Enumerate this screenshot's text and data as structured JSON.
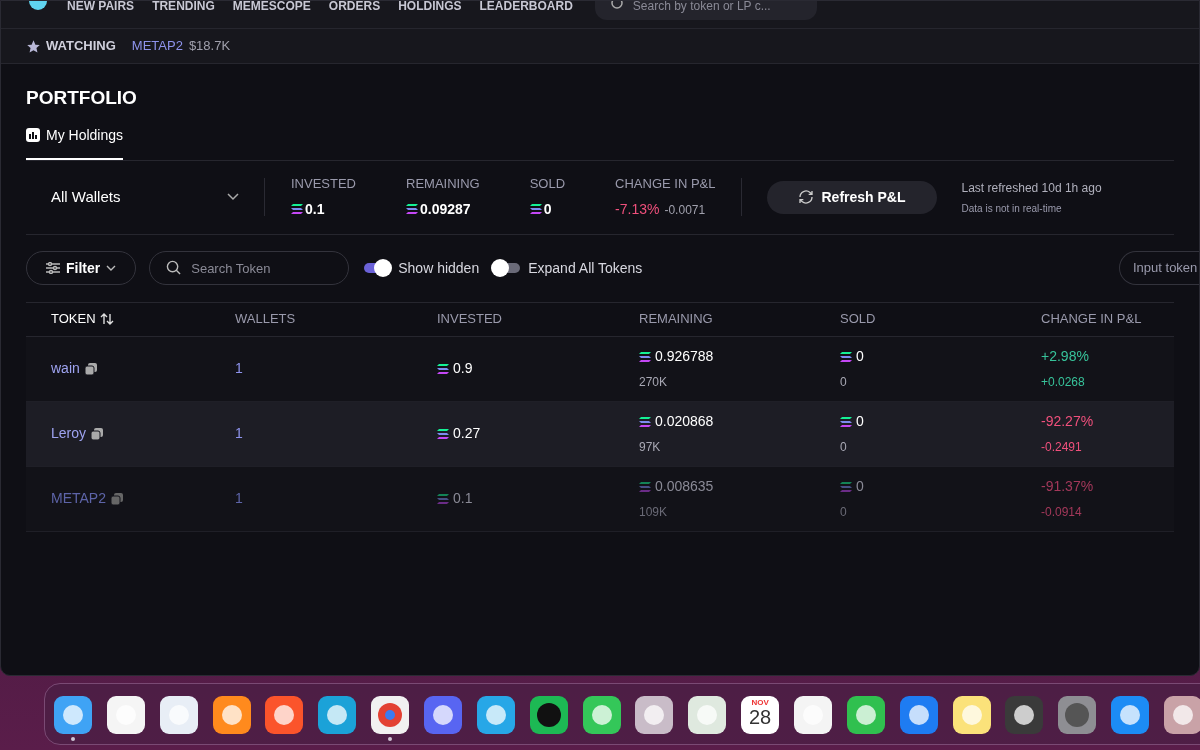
{
  "nav": {
    "items": [
      "NEW PAIRS",
      "TRENDING",
      "MEMESCOPE",
      "ORDERS",
      "HOLDINGS",
      "LEADERBOARD"
    ],
    "search": {
      "placeholder": "Search by token or LP c..."
    }
  },
  "watchlist": {
    "label": "WATCHING",
    "items": [
      {
        "symbol": "METAP2",
        "price": "$18.7K"
      }
    ]
  },
  "page_title": "PORTFOLIO",
  "tabs": [
    {
      "label": "My Holdings",
      "selected": true
    }
  ],
  "summary": {
    "wallet_select": "All Wallets",
    "stats": [
      {
        "label": "INVESTED",
        "value": "0.1",
        "kind": "sol"
      },
      {
        "label": "REMAINING",
        "value": "0.09287",
        "kind": "sol"
      },
      {
        "label": "SOLD",
        "value": "0",
        "kind": "sol"
      },
      {
        "label": "CHANGE IN P&L",
        "value": "-7.13%",
        "sub": "-0.0071",
        "kind": "pnl",
        "positive": false
      }
    ],
    "refresh_button": "Refresh P&L",
    "last_refreshed": "Last refreshed 10d 1h ago",
    "note": "Data is not in real-time"
  },
  "toolbar": {
    "filter": "Filter",
    "search": {
      "placeholder": "Search Token"
    },
    "toggles": [
      {
        "label": "Show hidden",
        "on": true
      },
      {
        "label": "Expand All Tokens",
        "on": false
      }
    ],
    "input": {
      "placeholder": "Input token"
    }
  },
  "table": {
    "columns": [
      "TOKEN",
      "WALLETS",
      "INVESTED",
      "REMAINING",
      "SOLD",
      "CHANGE IN P&L"
    ],
    "rows": [
      {
        "token": "wain",
        "wallets": "1",
        "invested": "0.9",
        "remaining": "0.926788",
        "remaining_sub": "270K",
        "sold": "0",
        "sold_sub": "0",
        "pnl": "+2.98%",
        "pnl_sub": "+0.0268",
        "positive": true,
        "hidden": false,
        "selected": false
      },
      {
        "token": "Leroy",
        "wallets": "1",
        "invested": "0.27",
        "remaining": "0.020868",
        "remaining_sub": "97K",
        "sold": "0",
        "sold_sub": "0",
        "pnl": "-92.27%",
        "pnl_sub": "-0.2491",
        "positive": false,
        "hidden": false,
        "selected": true
      },
      {
        "token": "METAP2",
        "wallets": "1",
        "invested": "0.1",
        "remaining": "0.008635",
        "remaining_sub": "109K",
        "sold": "0",
        "sold_sub": "0",
        "pnl": "-91.37%",
        "pnl_sub": "-0.0914",
        "positive": false,
        "hidden": true,
        "selected": false
      }
    ]
  },
  "dock": {
    "apps": [
      {
        "kind": "finder",
        "running": true
      },
      {
        "kind": "photos",
        "running": false
      },
      {
        "kind": "compass",
        "running": false
      },
      {
        "kind": "fox",
        "running": false
      },
      {
        "kind": "lion",
        "running": false
      },
      {
        "kind": "wave",
        "running": false
      },
      {
        "kind": "chrome",
        "running": true
      },
      {
        "kind": "chat",
        "running": false
      },
      {
        "kind": "plane",
        "running": false
      },
      {
        "kind": "music",
        "running": false
      },
      {
        "kind": "bubble",
        "running": false
      },
      {
        "kind": "grid",
        "running": false
      },
      {
        "kind": "map",
        "running": false
      },
      {
        "kind": "calendar",
        "running": false,
        "month": "NOV",
        "day": "28"
      },
      {
        "kind": "camera",
        "running": false
      },
      {
        "kind": "video",
        "running": false
      },
      {
        "kind": "easel",
        "running": false
      },
      {
        "kind": "notes",
        "running": false
      },
      {
        "kind": "calc",
        "running": false
      },
      {
        "kind": "gear",
        "running": false
      },
      {
        "kind": "store",
        "running": false
      },
      {
        "kind": "phone",
        "running": false
      }
    ]
  }
}
